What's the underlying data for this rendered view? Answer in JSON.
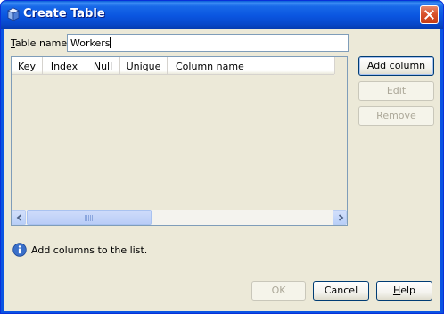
{
  "window": {
    "title": "Create Table",
    "icon": "database-cube-icon"
  },
  "form": {
    "table_name_label": "Table name:",
    "table_name_mnemonic": "T",
    "table_name_rest": "able name:",
    "table_name_value": "Workers"
  },
  "table": {
    "columns": [
      "Key",
      "Index",
      "Null",
      "Unique",
      "Column name"
    ],
    "rows": []
  },
  "side_buttons": {
    "add_column": "Add column",
    "add_column_mnemonic": "A",
    "add_column_rest": "dd column",
    "edit": "Edit",
    "edit_mnemonic": "E",
    "edit_rest": "dit",
    "remove": "Remove",
    "remove_mnemonic": "R",
    "remove_rest": "emove"
  },
  "info": {
    "icon": "info-icon",
    "message": "Add columns to the list."
  },
  "footer": {
    "ok": "OK",
    "cancel": "Cancel",
    "help": "Help",
    "help_mnemonic": "H",
    "help_rest": "elp"
  },
  "colors": {
    "titlebar": "#0a55e0",
    "client_bg": "#ece9d8",
    "close_button": "#d9532c",
    "disabled_text": "#aca899"
  }
}
